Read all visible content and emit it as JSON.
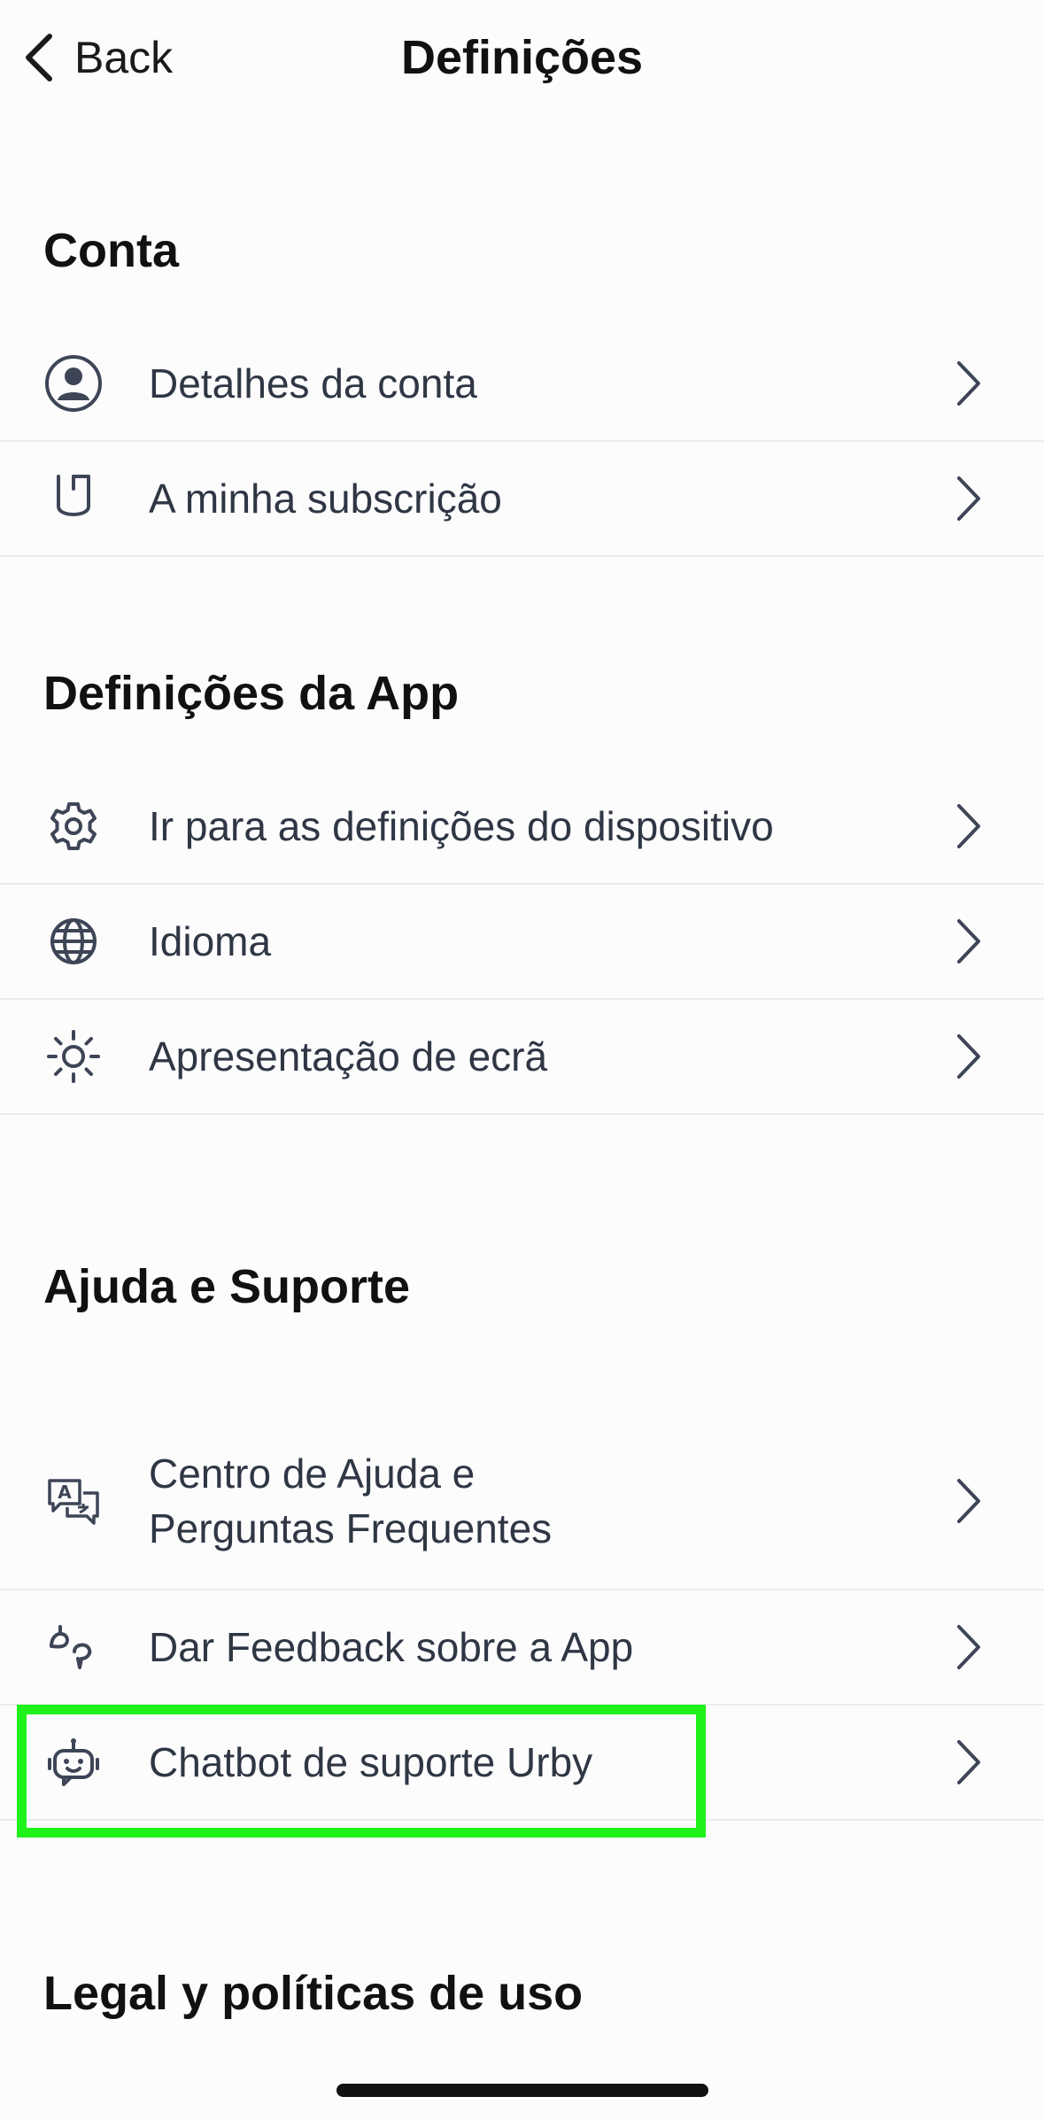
{
  "nav": {
    "back_label": "Back",
    "title": "Definições"
  },
  "sections": {
    "conta": "Conta",
    "app": "Definições da App",
    "ajuda": "Ajuda e Suporte",
    "legal": "Legal y políticas de uso"
  },
  "rows": {
    "account_details": {
      "label": "Detalhes da conta",
      "icon": "user-circle-icon"
    },
    "subscription": {
      "label": "A minha subscrição",
      "icon": "badge-icon"
    },
    "device_settings": {
      "label": "Ir para as definições do dispositivo",
      "icon": "gear-icon"
    },
    "language": {
      "label": "Idioma",
      "icon": "globe-icon"
    },
    "display": {
      "label": "Apresentação de ecrã",
      "icon": "sun-icon"
    },
    "help_center": {
      "label_line1": "Centro de Ajuda e",
      "label_line2": "Perguntas Frequentes",
      "icon": "chat-translate-icon"
    },
    "feedback": {
      "label": "Dar Feedback sobre a App",
      "icon": "feedback-icon"
    },
    "chatbot": {
      "label": "Chatbot de suporte Urby",
      "icon": "robot-icon"
    }
  },
  "colors": {
    "text": "#111111",
    "row_text": "#2f3644",
    "icon": "#3d4556",
    "divider": "#ececef",
    "highlight": "#1ff21b"
  }
}
